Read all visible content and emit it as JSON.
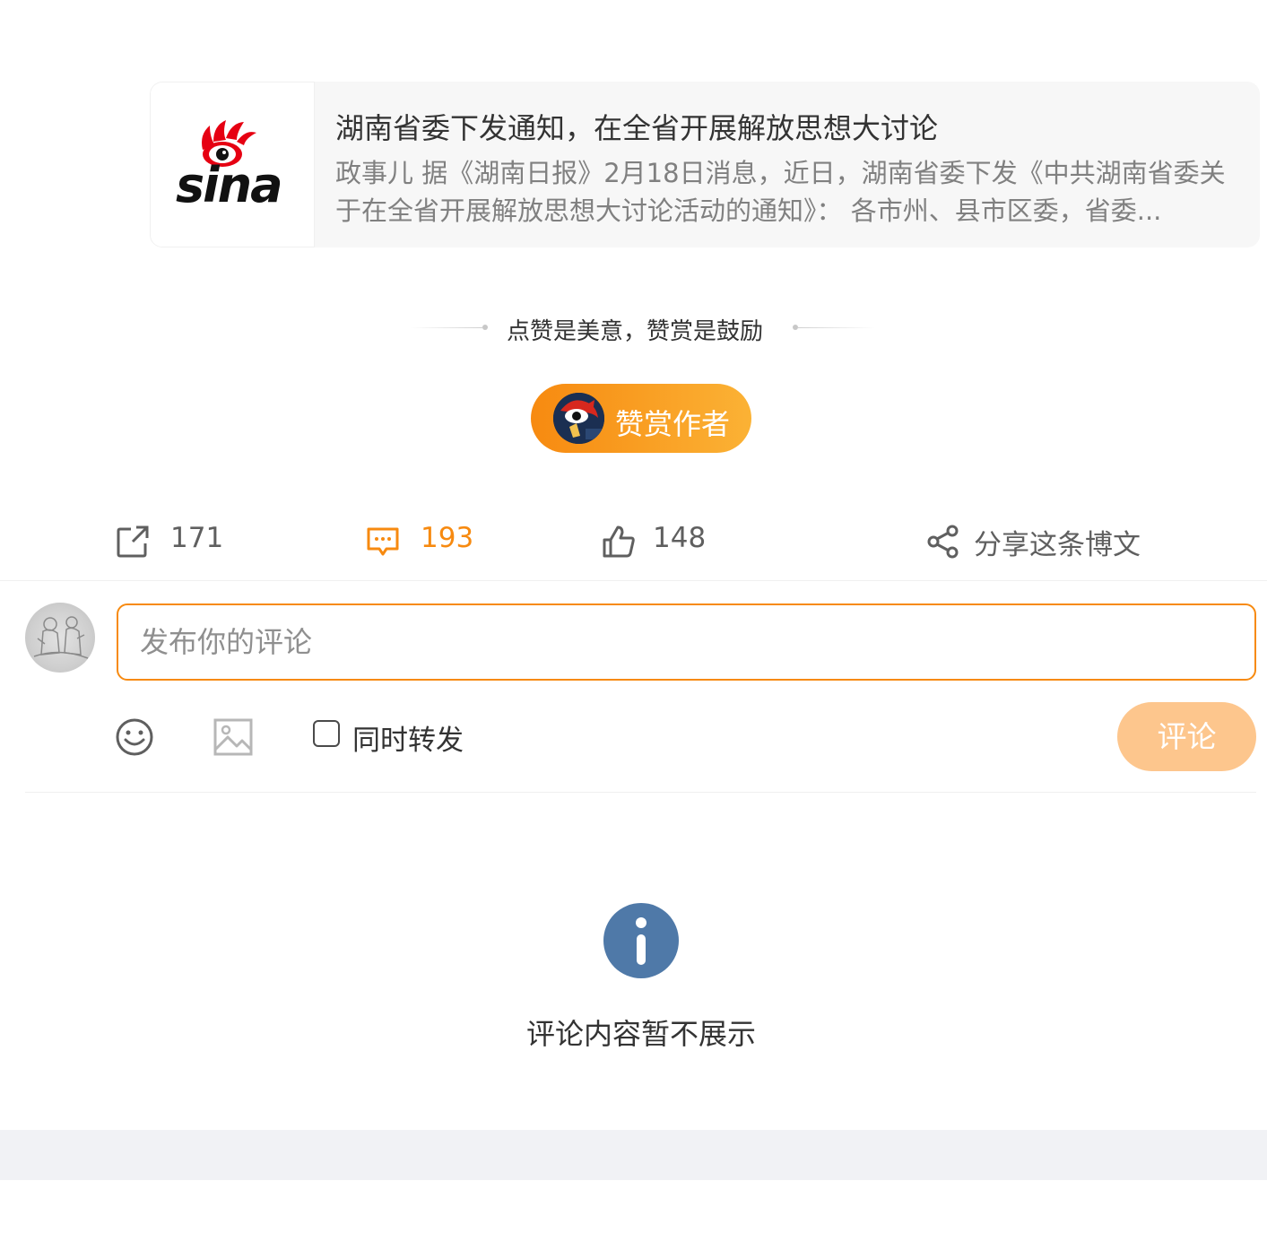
{
  "card": {
    "logo_text": "sina",
    "title": "湖南省委下发通知，在全省开展解放思想大讨论",
    "description": "政事儿 据《湖南日报》2月18日消息，近日，湖南省委下发《中共湖南省委关于在全省开展解放思想大讨论活动的通知》： 各市州、县市区委，省委..."
  },
  "reward": {
    "caption": "点赞是美意，赞赏是鼓励",
    "button_label": "赞赏作者"
  },
  "actions": {
    "forward_count": "171",
    "comment_count": "193",
    "like_count": "148",
    "share_label": "分享这条博文"
  },
  "comment_box": {
    "placeholder": "发布你的评论",
    "forward_label": "同时转发",
    "submit_label": "评论"
  },
  "notice": {
    "text": "评论内容暂不展示"
  },
  "colors": {
    "accent": "#f78a10",
    "submit_disabled": "#fdc68d",
    "info": "#4f79a8",
    "card_bg": "#f7f7f7"
  }
}
